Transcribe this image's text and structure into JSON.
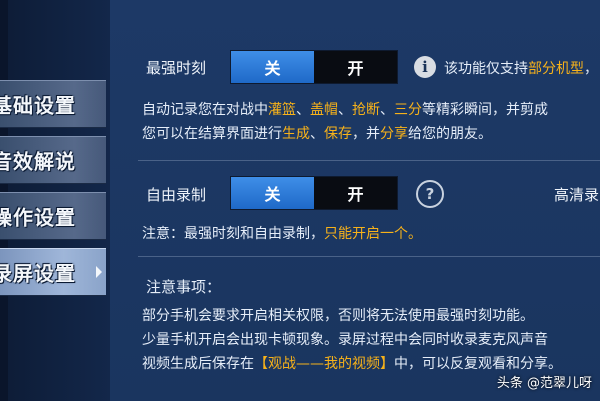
{
  "sidebar": {
    "items": [
      {
        "label": "基础设置"
      },
      {
        "label": "音效解说"
      },
      {
        "label": "操作设置"
      },
      {
        "label": "录屏设置"
      }
    ]
  },
  "highlight": {
    "label": "最强时刻",
    "toggle_off_label": "关",
    "toggle_on_label": "开",
    "info_text_prefix": "该功能仅支持",
    "info_text_highlight": "部分机型",
    "info_text_suffix": "，",
    "desc1_prefix": "自动记录您在对战中",
    "desc1_items": [
      "灌篮",
      "盖帽",
      "抢断",
      "三分"
    ],
    "desc1_sep": "、",
    "desc1_suffix": "等精彩瞬间，并剪成",
    "desc2_prefix": "您可以在结算界面进行",
    "desc2_item1": "生成",
    "desc2_sep": "、",
    "desc2_item2": "保存",
    "desc2_mid": "，并",
    "desc2_item3": "分享",
    "desc2_suffix": "给您的朋友。"
  },
  "free_record": {
    "label": "自由录制",
    "toggle_off_label": "关",
    "toggle_on_label": "开",
    "hd_label": "高清录",
    "note_prefix": "注意：最强时刻和自由录制，",
    "note_highlight": "只能开启一个。"
  },
  "notes": {
    "title": "注意事项：",
    "line1": "部分手机会要求开启相关权限，否则将无法使用最强时刻功能。",
    "line2": "少量手机开启会出现卡顿现象。录屏过程中会同时收录麦克风声音",
    "line3_prefix": "视频生成后保存在",
    "line3_highlight": "【观战——我的视频】",
    "line3_suffix": "中，可以反复观看和分享。"
  },
  "watermark": "头条 @范翠儿呀",
  "colors": {
    "accent": "#f7b21a",
    "toggle_on": "#2d7fdc",
    "toggle_off": "#090c12",
    "background": "#1b365f"
  }
}
